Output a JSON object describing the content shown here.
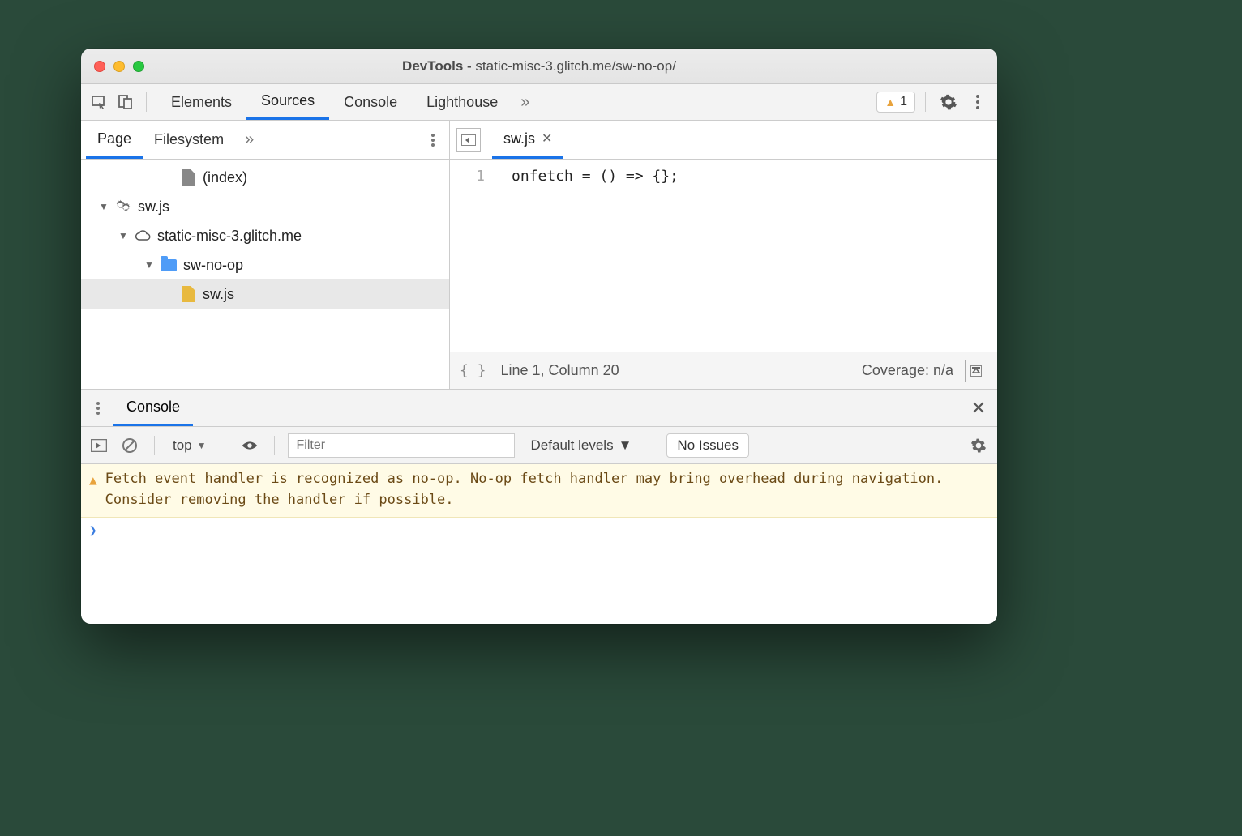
{
  "window": {
    "title_prefix": "DevTools - ",
    "title_url": "static-misc-3.glitch.me/sw-no-op/"
  },
  "main_tabs": {
    "items": [
      "Elements",
      "Sources",
      "Console",
      "Lighthouse"
    ],
    "active": "Sources",
    "warning_count": "1"
  },
  "sources_sidebar": {
    "tabs": [
      "Page",
      "Filesystem"
    ],
    "active": "Page"
  },
  "tree": {
    "index_label": "(index)",
    "sw_root": "sw.js",
    "domain": "static-misc-3.glitch.me",
    "folder": "sw-no-op",
    "file": "sw.js"
  },
  "editor": {
    "tab": "sw.js",
    "line_number": "1",
    "code": "onfetch = () => {};",
    "status_line": "Line 1, Column 20",
    "coverage": "Coverage: n/a"
  },
  "drawer": {
    "tab": "Console"
  },
  "console_toolbar": {
    "context": "top",
    "filter_placeholder": "Filter",
    "levels": "Default levels",
    "issues": "No Issues"
  },
  "console_log": {
    "warning": "Fetch event handler is recognized as no-op. No-op fetch handler may bring overhead during navigation. Consider removing the handler if possible."
  }
}
